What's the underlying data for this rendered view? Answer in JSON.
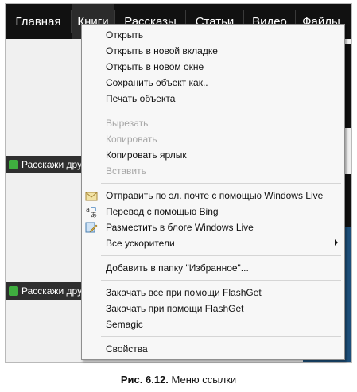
{
  "topnav": {
    "items": [
      "Главная",
      "Книги",
      "Рассказы",
      "Статьи",
      "Видео",
      "Файлы"
    ]
  },
  "page": {
    "bar_text": "Расскажи дру"
  },
  "menu": {
    "group1": [
      "Открыть",
      "Открыть в новой вкладке",
      "Открыть в новом окне",
      "Сохранить объект как..",
      "Печать объекта"
    ],
    "group2": [
      "Вырезать",
      "Копировать",
      "Копировать ярлык",
      "Вставить"
    ],
    "group3": [
      "Отправить по эл. почте с помощью Windows Live",
      "Перевод с помощью Bing",
      "Разместить в блоге Windows Live",
      "Все ускорители"
    ],
    "group4": [
      "Добавить в папку \"Избранное\"..."
    ],
    "group5": [
      "Закачать все при помощи FlashGet",
      "Закачать при помощи FlashGet",
      "Semagic"
    ],
    "group6": [
      "Свойства"
    ]
  },
  "caption": {
    "label": "Рис. 6.12.",
    "text": "Меню ссылки"
  }
}
